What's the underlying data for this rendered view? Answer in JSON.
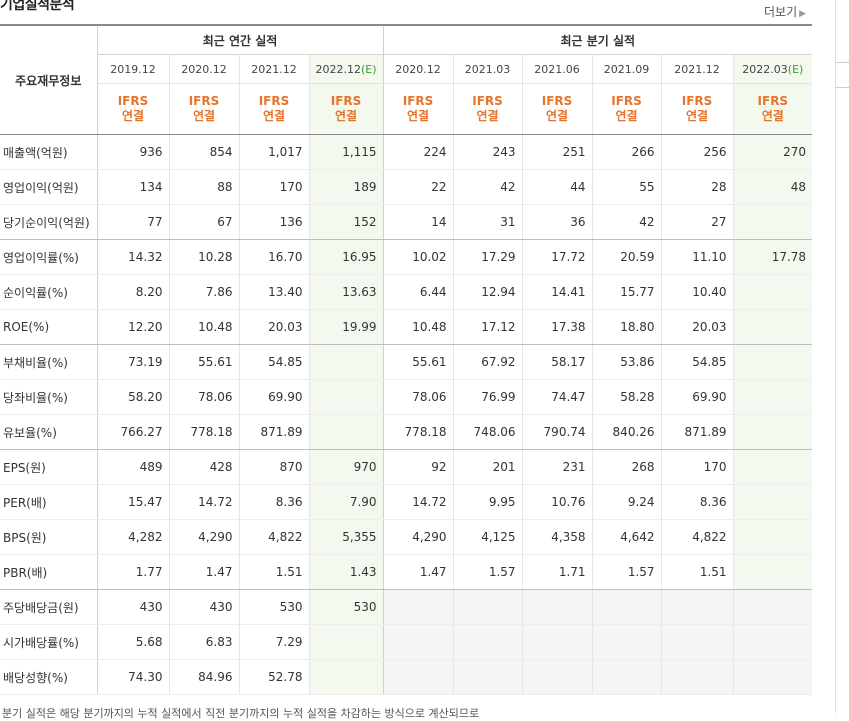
{
  "section": {
    "title": "기업실적분석",
    "more_label": "더보기"
  },
  "table": {
    "label_header": "주요재무정보",
    "annual_header": "최근 연간 실적",
    "quarter_header": "최근 분기 실적",
    "annual_periods": [
      "2019.12",
      "2020.12",
      "2021.12",
      "2022.12"
    ],
    "quarter_periods": [
      "2020.12",
      "2021.03",
      "2021.06",
      "2021.09",
      "2021.12",
      "2022.03"
    ],
    "estimate_mark": "(E)",
    "basis_top": "IFRS",
    "basis_bottom": "연결",
    "rows": [
      {
        "label": "매출액(억원)",
        "values": [
          "936",
          "854",
          "1,017",
          "1,115",
          "224",
          "243",
          "251",
          "266",
          "256",
          "270"
        ]
      },
      {
        "label": "영업이익(억원)",
        "values": [
          "134",
          "88",
          "170",
          "189",
          "22",
          "42",
          "44",
          "55",
          "28",
          "48"
        ]
      },
      {
        "label": "당기순이익(억원)",
        "values": [
          "77",
          "67",
          "136",
          "152",
          "14",
          "31",
          "36",
          "42",
          "27",
          ""
        ]
      },
      {
        "label": "영업이익률(%)",
        "values": [
          "14.32",
          "10.28",
          "16.70",
          "16.95",
          "10.02",
          "17.29",
          "17.72",
          "20.59",
          "11.10",
          "17.78"
        ]
      },
      {
        "label": "순이익률(%)",
        "values": [
          "8.20",
          "7.86",
          "13.40",
          "13.63",
          "6.44",
          "12.94",
          "14.41",
          "15.77",
          "10.40",
          ""
        ]
      },
      {
        "label": "ROE(%)",
        "values": [
          "12.20",
          "10.48",
          "20.03",
          "19.99",
          "10.48",
          "17.12",
          "17.38",
          "18.80",
          "20.03",
          ""
        ]
      },
      {
        "label": "부채비율(%)",
        "values": [
          "73.19",
          "55.61",
          "54.85",
          "",
          "55.61",
          "67.92",
          "58.17",
          "53.86",
          "54.85",
          ""
        ]
      },
      {
        "label": "당좌비율(%)",
        "values": [
          "58.20",
          "78.06",
          "69.90",
          "",
          "78.06",
          "76.99",
          "74.47",
          "58.28",
          "69.90",
          ""
        ]
      },
      {
        "label": "유보율(%)",
        "values": [
          "766.27",
          "778.18",
          "871.89",
          "",
          "778.18",
          "748.06",
          "790.74",
          "840.26",
          "871.89",
          ""
        ]
      },
      {
        "label": "EPS(원)",
        "values": [
          "489",
          "428",
          "870",
          "970",
          "92",
          "201",
          "231",
          "268",
          "170",
          ""
        ]
      },
      {
        "label": "PER(배)",
        "values": [
          "15.47",
          "14.72",
          "8.36",
          "7.90",
          "14.72",
          "9.95",
          "10.76",
          "9.24",
          "8.36",
          ""
        ]
      },
      {
        "label": "BPS(원)",
        "values": [
          "4,282",
          "4,290",
          "4,822",
          "5,355",
          "4,290",
          "4,125",
          "4,358",
          "4,642",
          "4,822",
          ""
        ]
      },
      {
        "label": "PBR(배)",
        "values": [
          "1.77",
          "1.47",
          "1.51",
          "1.43",
          "1.47",
          "1.57",
          "1.71",
          "1.57",
          "1.51",
          ""
        ]
      },
      {
        "label": "주당배당금(원)",
        "values": [
          "430",
          "430",
          "530",
          "530",
          "",
          "",
          "",
          "",
          "",
          ""
        ]
      },
      {
        "label": "시가배당률(%)",
        "values": [
          "5.68",
          "6.83",
          "7.29",
          "",
          "",
          "",
          "",
          "",
          "",
          ""
        ]
      },
      {
        "label": "배당성향(%)",
        "values": [
          "74.30",
          "84.96",
          "52.78",
          "",
          "",
          "",
          "",
          "",
          "",
          ""
        ]
      }
    ]
  },
  "footnote": "분기 실적은 해당 분기까지의 누적 실적에서 직전 분기까지의 누적 실적을 차감하는 방식으로 계산되므로"
}
